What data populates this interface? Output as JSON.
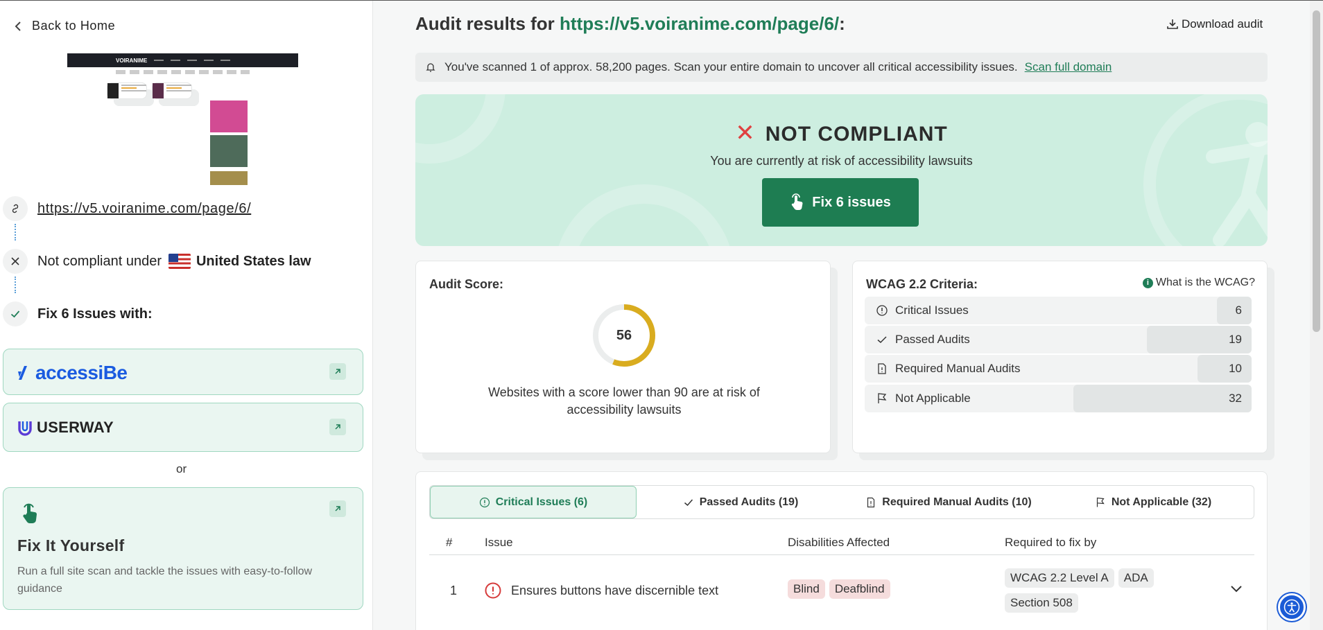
{
  "sidebar": {
    "back_label": "Back to Home",
    "thumbnail_logo": "VOIRANIME",
    "url": "https://v5.voiranime.com/page/6/",
    "compliance_prefix": "Not compliant under",
    "compliance_law": "United States law",
    "fix_label": "Fix 6 Issues with:",
    "vendors": [
      {
        "name": "accessiBe"
      },
      {
        "name": "USERWAY"
      }
    ],
    "or_label": "or",
    "fix_yourself": {
      "title": "Fix It Yourself",
      "description": "Run a full site scan and tackle the issues with easy-to-follow guidance"
    }
  },
  "main": {
    "title_prefix": "Audit results for",
    "title_url": "https://v5.voiranime.com/page/6/",
    "title_suffix": ":",
    "download_label": "Download audit",
    "notice": {
      "text": "You've scanned 1 of approx. 58,200 pages. Scan your entire domain to uncover all critical accessibility issues.",
      "link": "Scan full domain"
    },
    "hero": {
      "status": "NOT COMPLIANT",
      "subtitle": "You are currently at risk of accessibility lawsuits",
      "button": "Fix 6 issues"
    },
    "score": {
      "title": "Audit Score:",
      "value": 56,
      "max": 100,
      "note": "Websites with a score lower than 90 are at risk of accessibility lawsuits"
    },
    "wcag": {
      "title": "WCAG 2.2 Criteria:",
      "help": "What is the WCAG?",
      "rows": [
        {
          "label": "Critical Issues",
          "count": "6",
          "icon": "alert-circle-icon",
          "share": 0.09
        },
        {
          "label": "Passed Audits",
          "count": "19",
          "icon": "check-icon",
          "share": 0.27
        },
        {
          "label": "Required Manual Audits",
          "count": "10",
          "icon": "document-icon",
          "share": 0.14
        },
        {
          "label": "Not Applicable",
          "count": "32",
          "icon": "flag-icon",
          "share": 0.46
        }
      ]
    },
    "tabs": [
      {
        "label": "Critical Issues (6)"
      },
      {
        "label": "Passed Audits (19)"
      },
      {
        "label": "Required Manual Audits (10)"
      },
      {
        "label": "Not Applicable (32)"
      }
    ],
    "table": {
      "headers": [
        "#",
        "Issue",
        "Disabilities Affected",
        "Required to fix by"
      ],
      "rows": [
        {
          "num": "1",
          "issue": "Ensures buttons have discernible text",
          "disabilities": [
            "Blind",
            "Deafblind"
          ],
          "required": [
            "WCAG 2.2 Level A",
            "ADA",
            "Section 508"
          ]
        }
      ]
    }
  },
  "colors": {
    "brand_green": "#1f7d57",
    "hero_bg": "#cdeee0",
    "error_red": "#e04040",
    "gauge_yellow": "#d9ac1f"
  }
}
